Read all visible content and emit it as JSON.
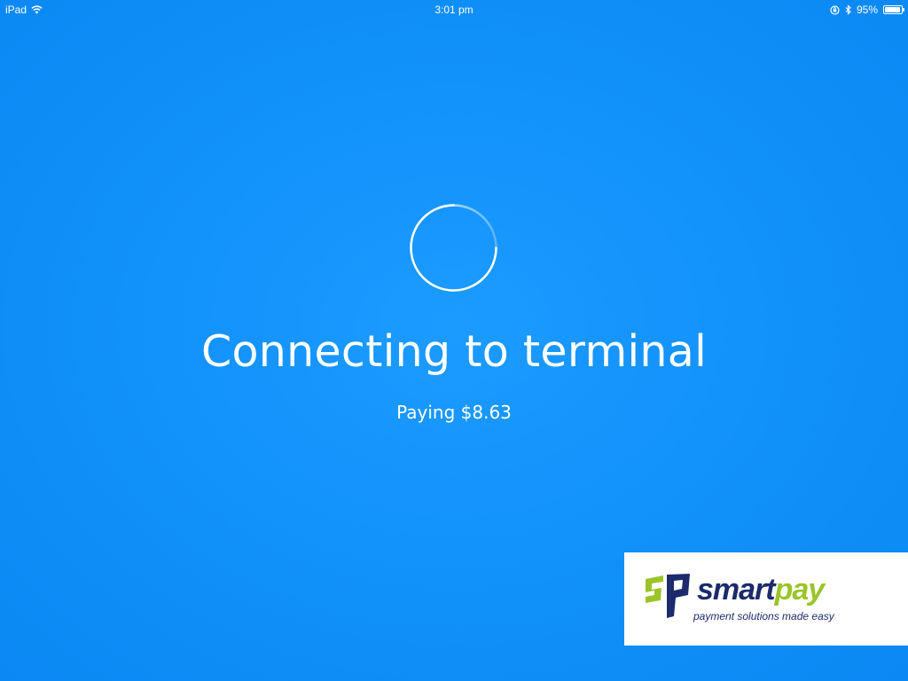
{
  "status_bar": {
    "device": "iPad",
    "time": "3:01 pm",
    "battery_percent": "95%",
    "battery_level": 0.95,
    "icons": [
      "wifi-icon",
      "orientation-lock-icon",
      "bluetooth-icon",
      "battery-icon"
    ]
  },
  "main": {
    "spinner_icon": "loading-spinner-icon",
    "title": "Connecting to terminal",
    "subtitle": "Paying $8.63"
  },
  "logo": {
    "brand_part1": "smart",
    "brand_part2": "pay",
    "tagline": "payment solutions made easy",
    "colors": {
      "navy": "#1c2b6b",
      "green": "#9bc428"
    }
  },
  "colors": {
    "background": "#1292fb",
    "text": "#ffffff"
  }
}
